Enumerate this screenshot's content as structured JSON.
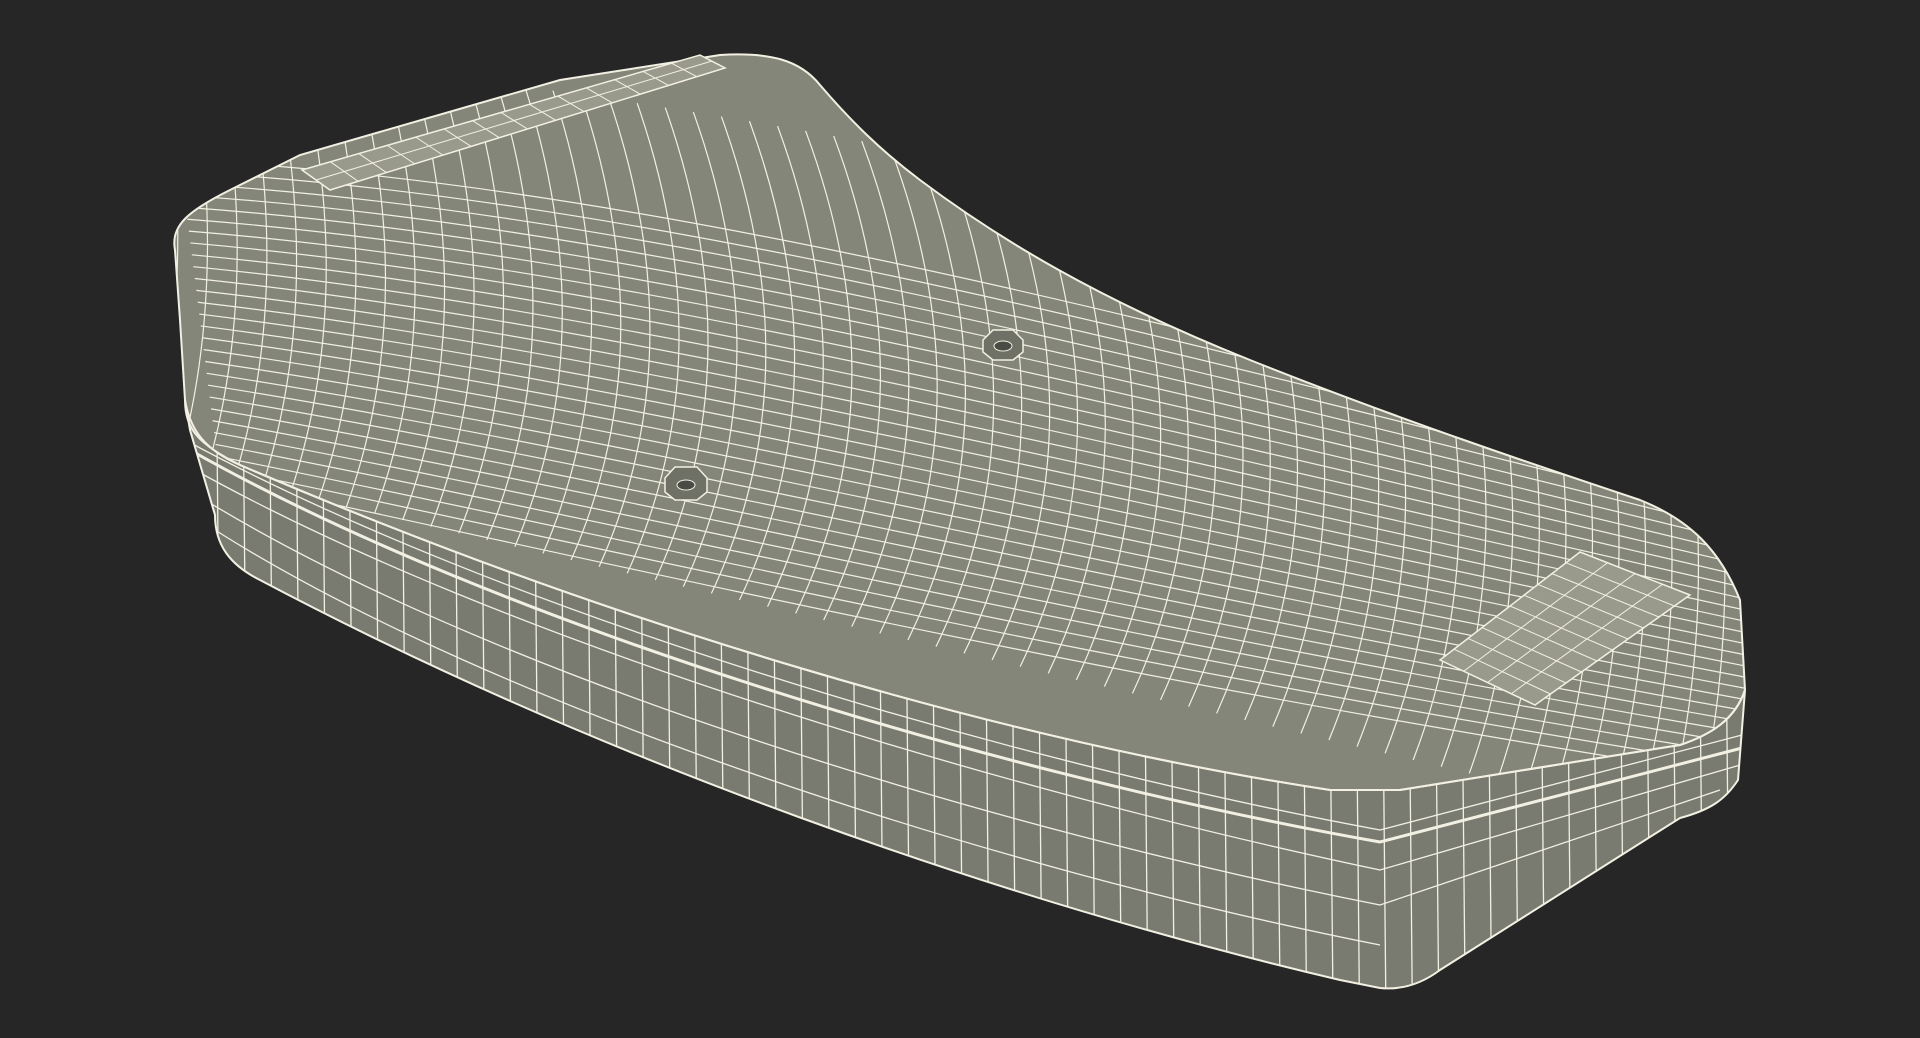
{
  "scene": {
    "subject": "wireframe-mesh-model",
    "colors": {
      "background": "#262626",
      "surface": "#85867a",
      "surface_shade": "#6f7066",
      "wire": "#f2f0e2",
      "pad": "#9a9a8c"
    },
    "features": {
      "screw_holes": 2,
      "grip_pads": 2
    }
  }
}
